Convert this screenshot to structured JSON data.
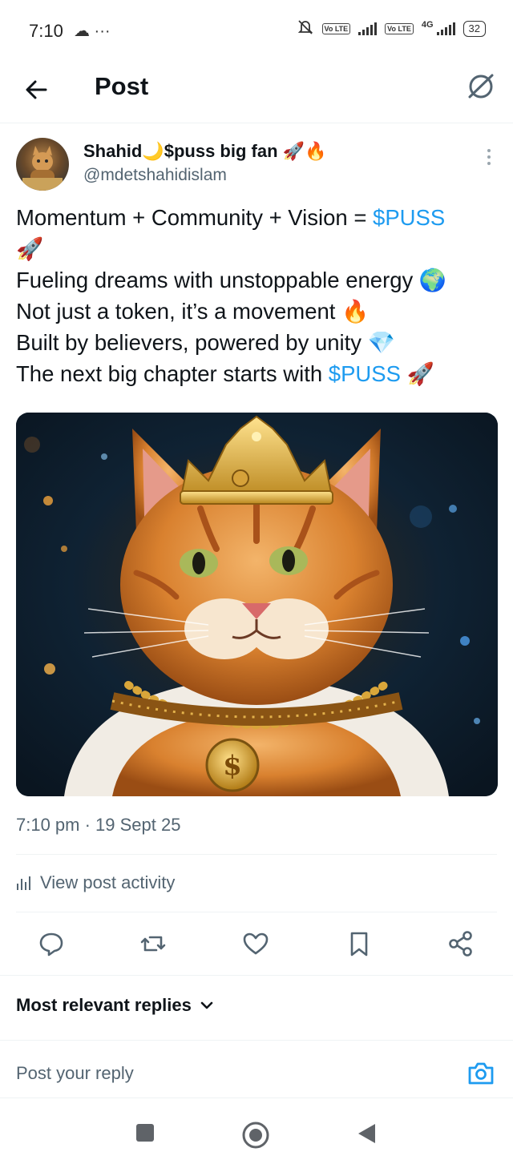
{
  "status_bar": {
    "time": "7:10",
    "left_icons": "☁ ···",
    "lte1": "Vo LTE",
    "lte2": "Vo LTE",
    "network": "4G",
    "battery": "32"
  },
  "header": {
    "title": "Post"
  },
  "author": {
    "display_name": "Shahid🌙$puss big fan 🚀🔥",
    "handle": "@mdetshahidislam"
  },
  "post": {
    "line1_text": "Momentum + Community + Vision = ",
    "line1_cashtag": "$PUSS",
    "line1_emoji": "🚀",
    "line2": "Fueling dreams with unstoppable energy 🌍",
    "line3": "Not just a token, it’s a movement 🔥",
    "line4": "Built by believers, powered by unity 💎",
    "line5_text": "The next big chapter starts with ",
    "line5_cashtag": "$PUSS",
    "line5_emoji": "🚀",
    "image_icon": "crowned-cat-image"
  },
  "meta": {
    "timestamp": "7:10 pm · 19 Sept 25",
    "view_activity": "View post activity"
  },
  "replies": {
    "sort_label": "Most relevant replies",
    "reply_placeholder": "Post your reply"
  },
  "colors": {
    "accent": "#1d9bf0",
    "text": "#0f1419",
    "secondary": "#536471"
  }
}
